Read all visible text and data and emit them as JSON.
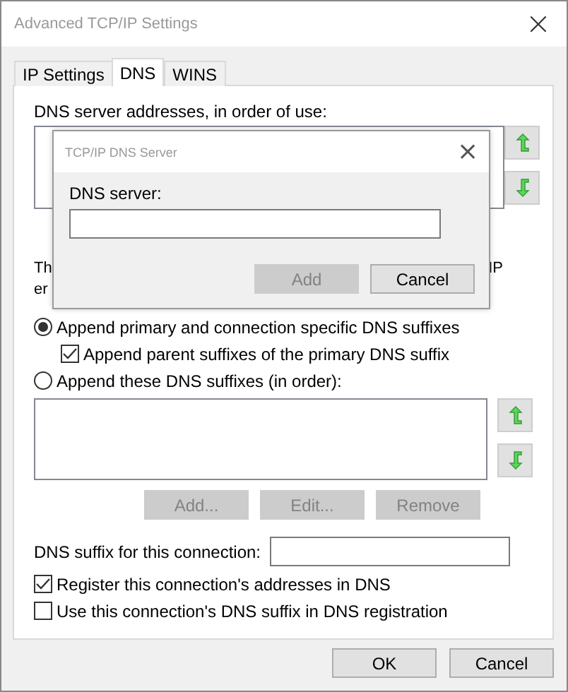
{
  "window": {
    "title": "Advanced TCP/IP Settings",
    "close": "×"
  },
  "tabs": [
    {
      "label": "IP Settings",
      "selected": false
    },
    {
      "label": "DNS",
      "selected": true
    },
    {
      "label": "WINS",
      "selected": false
    }
  ],
  "dns_servers": {
    "label": "DNS server addresses, in order of use:"
  },
  "partial_text": {
    "line_1_start": "Th",
    "line_1_end": "IP",
    "line_2_start": "er"
  },
  "options": [
    {
      "kind": "radio",
      "label": "Append primary and connection specific DNS suffixes",
      "checked": true,
      "indent": false
    },
    {
      "kind": "checkbox",
      "label": "Append parent suffixes of the primary DNS suffix",
      "checked": true,
      "indent": true
    },
    {
      "kind": "radio",
      "label": "Append these DNS suffixes (in order):",
      "checked": false,
      "indent": false
    }
  ],
  "suffix_buttons": [
    {
      "label": "Add...",
      "disabled": true
    },
    {
      "label": "Edit...",
      "disabled": true
    },
    {
      "label": "Remove",
      "disabled": true
    }
  ],
  "suffix_field": {
    "label": "DNS suffix for this connection:"
  },
  "registration": [
    {
      "label": "Register this connection's addresses in DNS",
      "checked": true
    },
    {
      "label": "Use this connection's DNS suffix in DNS registration",
      "checked": false
    }
  ],
  "buttons": [
    {
      "label": "OK",
      "disabled": false
    },
    {
      "label": "Cancel",
      "disabled": false
    }
  ],
  "dialog": {
    "title": "TCP/IP DNS Server",
    "close": "×",
    "field_label": "DNS server:",
    "buttons": [
      {
        "label": "Add",
        "disabled": true
      },
      {
        "label": "Cancel",
        "disabled": false
      }
    ]
  }
}
